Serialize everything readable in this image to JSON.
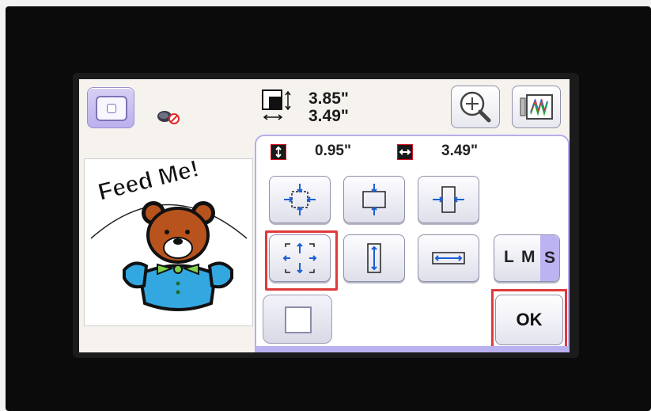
{
  "size_readout": {
    "height": "3.85\"",
    "width": "3.49\""
  },
  "dimensions": {
    "vertical": "0.95\"",
    "horizontal": "3.49\""
  },
  "preview": {
    "text": "Feed Me!"
  },
  "size_selector": {
    "large": "L",
    "medium": "M",
    "small": "S",
    "selected": "S"
  },
  "actions": {
    "ok_label": "OK"
  },
  "colors": {
    "panel_border": "#b5aeea",
    "selection_highlight": "#e03a3a",
    "accent_purple": "#bcb3f3"
  },
  "icons": {
    "pattern": "embroidery-pattern-icon",
    "thread": "no-thread-icon",
    "size": "size-readout-icon",
    "zoom": "zoom-in-icon",
    "frame": "frame-preview-icon"
  }
}
